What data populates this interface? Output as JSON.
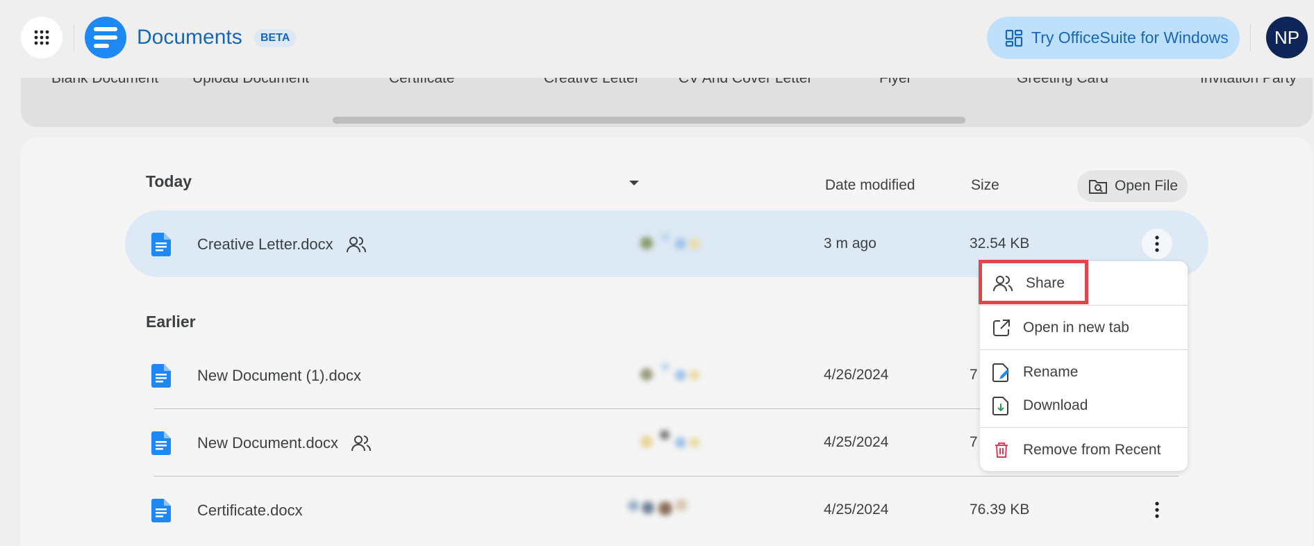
{
  "header": {
    "title": "Documents",
    "beta_badge": "BETA",
    "try_button": "Try OfficeSuite for Windows",
    "avatar_initials": "NP"
  },
  "templates": [
    "Blank Document",
    "Upload Document",
    "Certificate",
    "Creative Letter",
    "CV And Cover Letter",
    "Flyer",
    "Greeting Card",
    "Invitation Party"
  ],
  "list": {
    "today_title": "Today",
    "earlier_title": "Earlier",
    "col_date": "Date modified",
    "col_size": "Size",
    "open_file": "Open File"
  },
  "rows": [
    {
      "name": "Creative Letter.docx",
      "shared": true,
      "date": "3 m ago",
      "size": "32.54 KB"
    },
    {
      "name": "New Document (1).docx",
      "shared": false,
      "date": "4/26/2024",
      "size": "7"
    },
    {
      "name": "New Document.docx",
      "shared": true,
      "date": "4/25/2024",
      "size": "7"
    },
    {
      "name": "Certificate.docx",
      "shared": false,
      "date": "4/25/2024",
      "size": "76.39 KB"
    }
  ],
  "menu": {
    "share": "Share",
    "open_new_tab": "Open in new tab",
    "rename": "Rename",
    "download": "Download",
    "remove": "Remove from Recent"
  },
  "colors": {
    "accent": "#1e88f5",
    "selected_row": "#dde9f5",
    "highlight": "#e0464b",
    "danger": "#d93d59"
  }
}
